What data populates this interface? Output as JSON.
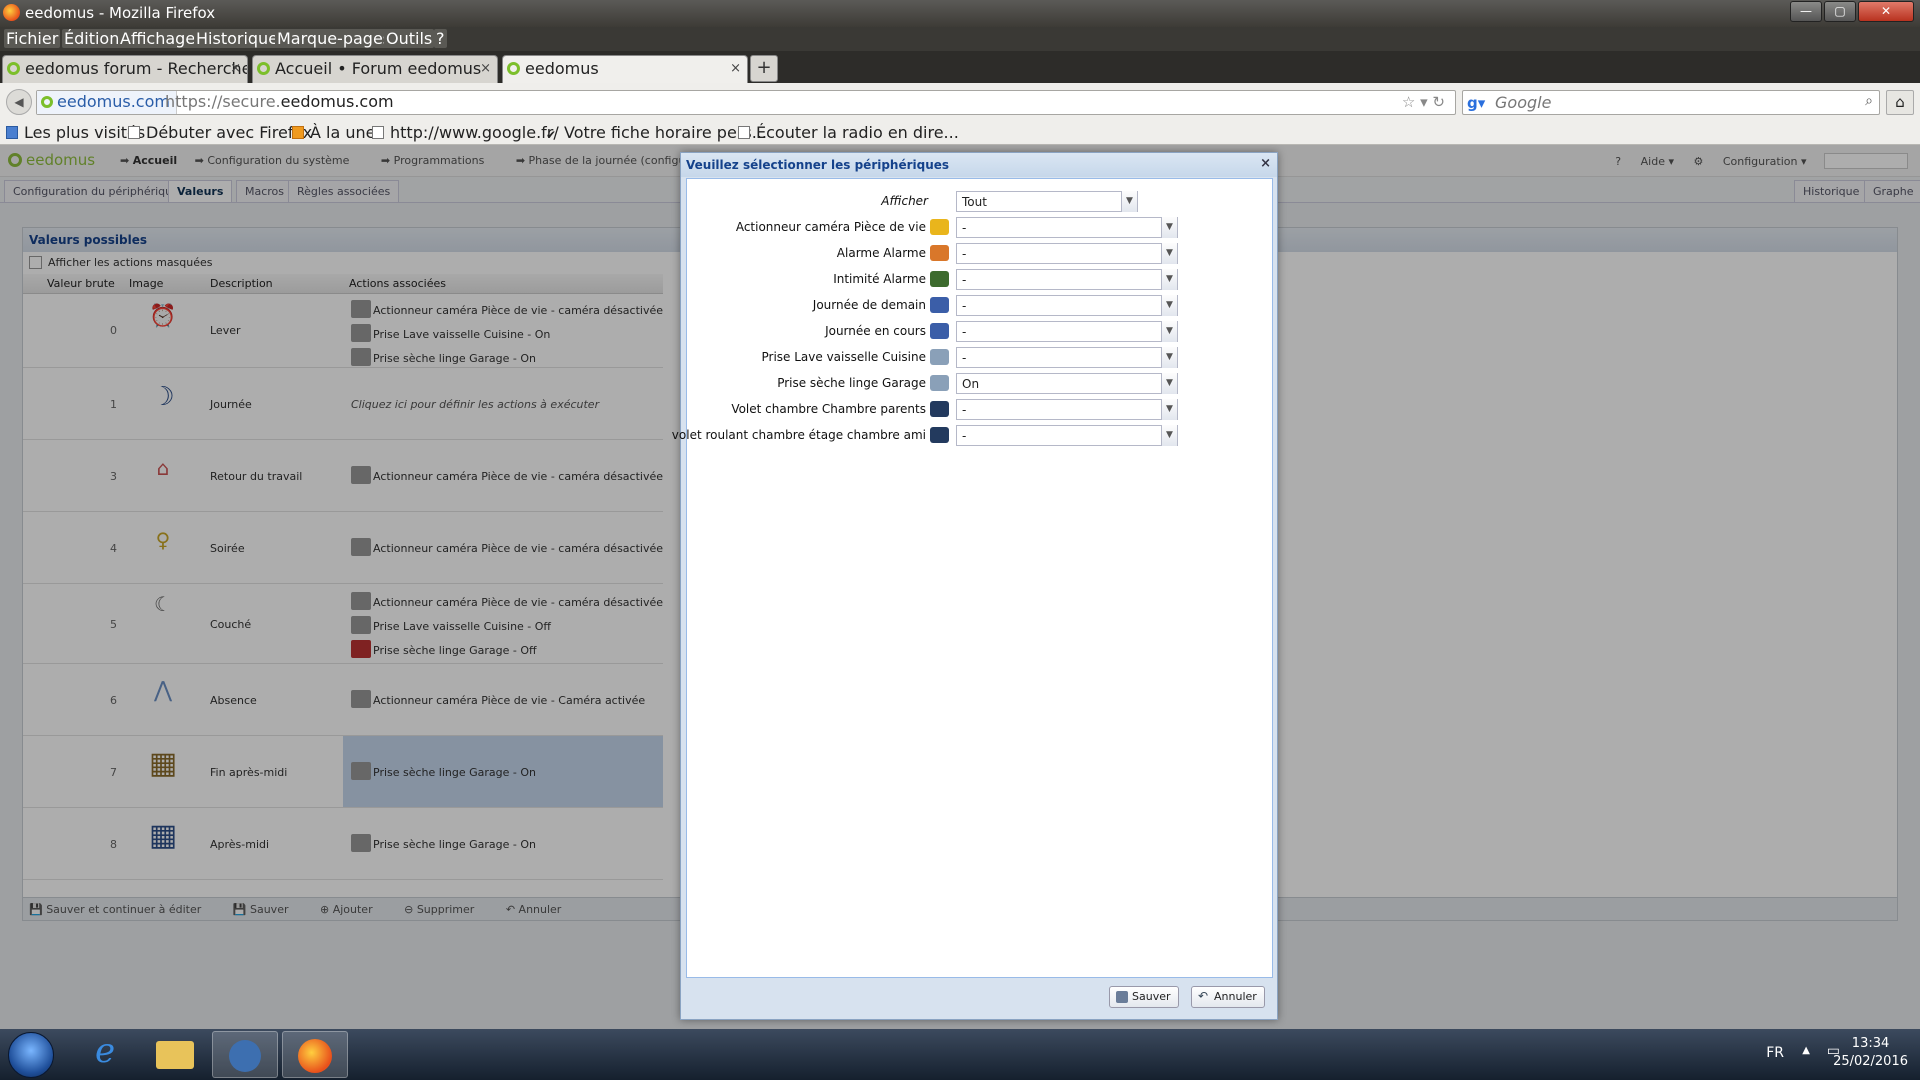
{
  "window": {
    "title": "eedomus - Mozilla Firefox",
    "min": "—",
    "max": "▢",
    "close": "✕"
  },
  "menu": [
    "Fichier",
    "Édition",
    "Affichage",
    "Historique",
    "Marque-pages",
    "Outils",
    "?"
  ],
  "tabs": [
    {
      "label": "eedomus forum - Recherche ...",
      "close": "×"
    },
    {
      "label": "Accueil • Forum eedomus",
      "close": "×"
    },
    {
      "label": "eedomus",
      "close": "×"
    }
  ],
  "new_tab": "+",
  "nav": {
    "site_identity": "eedomus.com",
    "url_prefix": "https://secure.",
    "url_domain": "eedomus.com",
    "search_placeholder": "Google"
  },
  "bookmarks": [
    "Les plus visités",
    "Débuter avec Firefox",
    "À la une",
    "http://www.google.fr/",
    "Votre fiche horaire pers...",
    "Écouter la radio en dire..."
  ],
  "app": {
    "logo": "eedomus",
    "breadcrumbs": [
      "Accueil",
      "Configuration du système",
      "Programmations",
      "Phase de la journée (configuration)"
    ],
    "help": "Aide",
    "config": "Configuration",
    "subtabs": [
      "Configuration du périphérique",
      "Valeurs",
      "Macros",
      "Règles associées"
    ],
    "right_tabs": [
      "Historique",
      "Graphe"
    ],
    "panel_title": "Valeurs possibles",
    "show_hidden": "Afficher les actions masquées",
    "columns": [
      "Valeur brute",
      "Image",
      "Description",
      "Actions associées"
    ],
    "rows": [
      {
        "value": "0",
        "desc": "Lever",
        "actions": [
          "Actionneur caméra Pièce de vie - caméra désactivée",
          "Prise Lave vaisselle Cuisine - On",
          "Prise sèche linge Garage - On"
        ]
      },
      {
        "value": "1",
        "desc": "Journée",
        "hint": "Cliquez ici pour définir les actions à exécuter",
        "actions": []
      },
      {
        "value": "3",
        "desc": "Retour du travail",
        "actions": [
          "Actionneur caméra Pièce de vie - caméra désactivée"
        ]
      },
      {
        "value": "4",
        "desc": "Soirée",
        "actions": [
          "Actionneur caméra Pièce de vie - caméra désactivée"
        ]
      },
      {
        "value": "5",
        "desc": "Couché",
        "actions": [
          "Actionneur caméra Pièce de vie - caméra désactivée",
          "Prise Lave vaisselle Cuisine - Off",
          "Prise sèche linge Garage - Off"
        ]
      },
      {
        "value": "6",
        "desc": "Absence",
        "actions": [
          "Actionneur caméra Pièce de vie - Caméra activée"
        ]
      },
      {
        "value": "7",
        "desc": "Fin après-midi",
        "actions": [
          "Prise sèche linge Garage - On"
        ]
      },
      {
        "value": "8",
        "desc": "Après-midi",
        "actions": [
          "Prise sèche linge Garage - On"
        ]
      }
    ],
    "toolbar": [
      "Sauver et continuer à éditer",
      "Sauver",
      "Ajouter",
      "Supprimer",
      "Annuler"
    ]
  },
  "dialog": {
    "title": "Veuillez sélectionner les périphériques",
    "close": "×",
    "filter_label": "Afficher",
    "filter_value": "Tout",
    "fields": [
      {
        "label": "Actionneur caméra Pièce de vie",
        "value": "-",
        "icon": "camera-icon",
        "color": "#e9b51c"
      },
      {
        "label": "Alarme Alarme",
        "value": "-",
        "icon": "house-alarm-icon",
        "color": "#d9772a"
      },
      {
        "label": "Intimité Alarme",
        "value": "-",
        "icon": "eye-check-icon",
        "color": "#3d6b2e"
      },
      {
        "label": "Journée de demain",
        "value": "-",
        "icon": "moon-icon",
        "color": "#3b5ea8"
      },
      {
        "label": "Journée en cours",
        "value": "-",
        "icon": "moon-icon",
        "color": "#3b5ea8"
      },
      {
        "label": "Prise Lave vaisselle Cuisine",
        "value": "-",
        "icon": "plug-icon",
        "color": "#8aa0b8"
      },
      {
        "label": "Prise sèche linge Garage",
        "value": "On",
        "icon": "plug-icon",
        "color": "#8aa0b8"
      },
      {
        "label": "Volet chambre Chambre parents",
        "value": "-",
        "icon": "shutter-icon",
        "color": "#233a5e"
      },
      {
        "label": "volet roulant chambre étage chambre ami",
        "value": "-",
        "icon": "shutter-icon",
        "color": "#233a5e"
      }
    ],
    "save": "Sauver",
    "cancel": "Annuler"
  },
  "taskbar": {
    "lang": "FR",
    "time": "13:34",
    "date": "25/02/2016"
  }
}
